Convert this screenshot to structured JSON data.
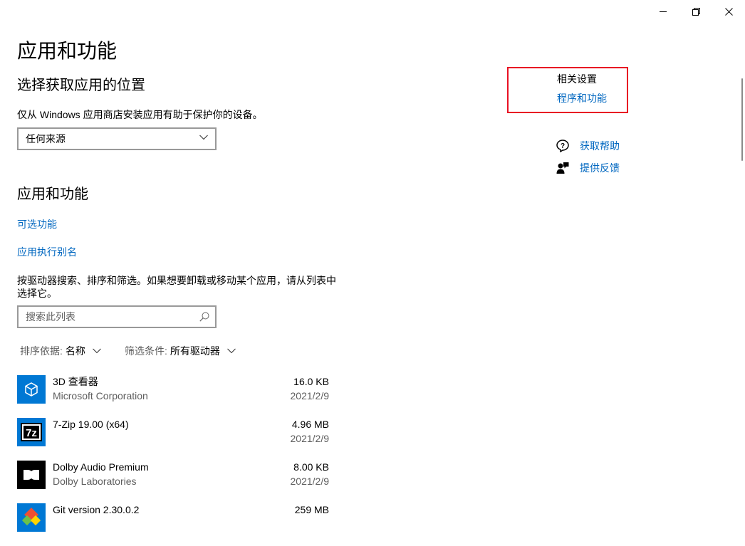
{
  "window": {
    "controls": {
      "minimize": "minimize-icon",
      "restore": "restore-icon",
      "close": "close-icon"
    }
  },
  "page": {
    "title": "应用和功能",
    "location_section": {
      "heading": "选择获取应用的位置",
      "description": "仅从 Windows 应用商店安装应用有助于保护你的设备。",
      "select_value": "任何来源"
    },
    "apps_section": {
      "heading": "应用和功能",
      "link_optional": "可选功能",
      "link_alias": "应用执行别名",
      "description_line1": "按驱动器搜索、排序和筛选。如果想要卸载或移动某个应用，请从列表中",
      "description_line2": "选择它。",
      "search_placeholder": "搜索此列表",
      "sort_label": "排序依据:",
      "sort_value": "名称",
      "filter_label": "筛选条件:",
      "filter_value": "所有驱动器"
    },
    "apps": [
      {
        "name": "3D 查看器",
        "publisher": "Microsoft Corporation",
        "size": "16.0 KB",
        "date": "2021/2/9",
        "icon": "3d-viewer-icon",
        "icon_bg": "#0078d4"
      },
      {
        "name": "7-Zip 19.00 (x64)",
        "publisher": "",
        "size": "4.96 MB",
        "date": "2021/2/9",
        "icon": "7zip-icon",
        "icon_bg": "#0078d4"
      },
      {
        "name": "Dolby Audio Premium",
        "publisher": "Dolby Laboratories",
        "size": "8.00 KB",
        "date": "2021/2/9",
        "icon": "dolby-icon",
        "icon_bg": "#000000"
      },
      {
        "name": "Git version 2.30.0.2",
        "publisher": "",
        "size": "259 MB",
        "date": "",
        "icon": "git-icon",
        "icon_bg": "#0078d4"
      }
    ],
    "related": {
      "title": "相关设置",
      "link": "程序和功能",
      "help_label": "获取帮助",
      "feedback_label": "提供反馈"
    }
  },
  "colors": {
    "accent": "#0067c0",
    "highlight_border": "#e81123",
    "secondary_text": "#5e5e5e"
  }
}
